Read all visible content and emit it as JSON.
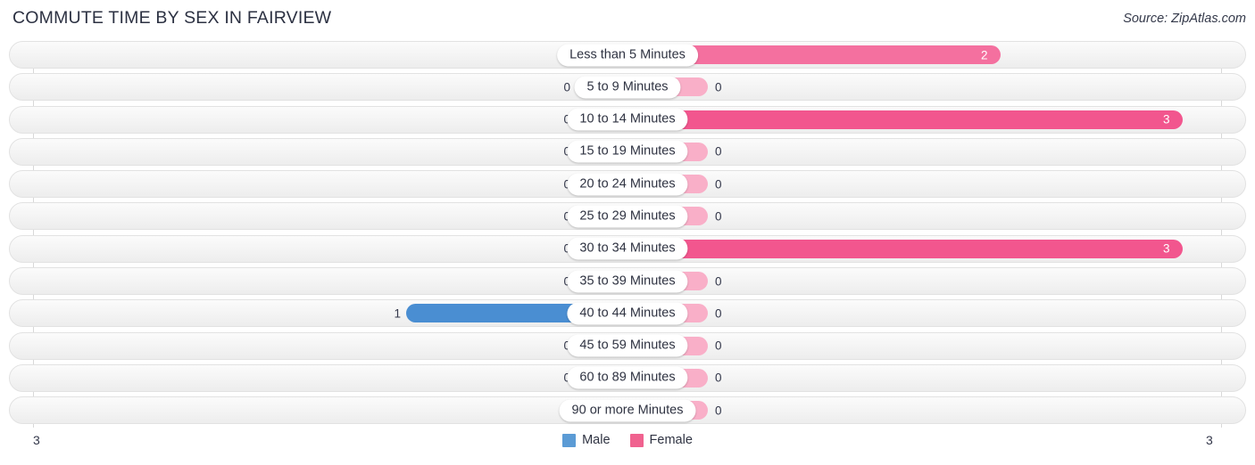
{
  "header": {
    "title": "COMMUTE TIME BY SEX IN FAIRVIEW",
    "source": "Source: ZipAtlas.com"
  },
  "legend": {
    "items": [
      {
        "label": "Male",
        "color": "#5B9BD5"
      },
      {
        "label": "Female",
        "color": "#F0628F"
      }
    ]
  },
  "axis": {
    "left_label": "3",
    "right_label": "3"
  },
  "colors": {
    "male_active": "#4A8ED2",
    "male_zero": "#A8C8EC",
    "female_active": "#F4709F",
    "female_high": "#F2568E",
    "female_zero": "#F9AFC8",
    "track": "#F4F4F4",
    "gridline": "#D8D8D8"
  },
  "chart_data": {
    "type": "bar",
    "title": "COMMUTE TIME BY SEX IN FAIRVIEW",
    "orientation": "horizontal",
    "layout": "diverging-bidirectional",
    "xlabel": "",
    "ylabel": "",
    "xlim": [
      3,
      3
    ],
    "grid": true,
    "legend_position": "bottom-center",
    "categories": [
      "Less than 5 Minutes",
      "5 to 9 Minutes",
      "10 to 14 Minutes",
      "15 to 19 Minutes",
      "20 to 24 Minutes",
      "25 to 29 Minutes",
      "30 to 34 Minutes",
      "35 to 39 Minutes",
      "40 to 44 Minutes",
      "45 to 59 Minutes",
      "60 to 89 Minutes",
      "90 or more Minutes"
    ],
    "series": [
      {
        "name": "Male",
        "values": [
          0,
          0,
          0,
          0,
          0,
          0,
          0,
          0,
          1,
          0,
          0,
          0
        ]
      },
      {
        "name": "Female",
        "values": [
          2,
          0,
          3,
          0,
          0,
          0,
          3,
          0,
          0,
          0,
          0,
          0
        ]
      }
    ]
  },
  "rows": [
    {
      "label": "Less than 5 Minutes",
      "male": "0",
      "female": "2",
      "male_w": 58,
      "male_zero": true,
      "female_w": 418,
      "female_zero": false,
      "female_high": false
    },
    {
      "label": "5 to 9 Minutes",
      "male": "0",
      "female": "0",
      "male_w": 58,
      "male_zero": true,
      "female_w": 90,
      "female_zero": true,
      "female_high": false
    },
    {
      "label": "10 to 14 Minutes",
      "male": "0",
      "female": "3",
      "male_w": 58,
      "male_zero": true,
      "female_w": 622,
      "female_zero": false,
      "female_high": true
    },
    {
      "label": "15 to 19 Minutes",
      "male": "0",
      "female": "0",
      "male_w": 58,
      "male_zero": true,
      "female_w": 90,
      "female_zero": true,
      "female_high": false
    },
    {
      "label": "20 to 24 Minutes",
      "male": "0",
      "female": "0",
      "male_w": 58,
      "male_zero": true,
      "female_w": 90,
      "female_zero": true,
      "female_high": false
    },
    {
      "label": "25 to 29 Minutes",
      "male": "0",
      "female": "0",
      "male_w": 58,
      "male_zero": true,
      "female_w": 90,
      "female_zero": true,
      "female_high": false
    },
    {
      "label": "30 to 34 Minutes",
      "male": "0",
      "female": "3",
      "male_w": 58,
      "male_zero": true,
      "female_w": 622,
      "female_zero": false,
      "female_high": true
    },
    {
      "label": "35 to 39 Minutes",
      "male": "0",
      "female": "0",
      "male_w": 58,
      "male_zero": true,
      "female_w": 90,
      "female_zero": true,
      "female_high": false
    },
    {
      "label": "40 to 44 Minutes",
      "male": "1",
      "female": "0",
      "male_w": 248,
      "male_zero": false,
      "female_w": 90,
      "female_zero": true,
      "female_high": false
    },
    {
      "label": "45 to 59 Minutes",
      "male": "0",
      "female": "0",
      "male_w": 58,
      "male_zero": true,
      "female_w": 90,
      "female_zero": true,
      "female_high": false
    },
    {
      "label": "60 to 89 Minutes",
      "male": "0",
      "female": "0",
      "male_w": 58,
      "male_zero": true,
      "female_w": 90,
      "female_zero": true,
      "female_high": false
    },
    {
      "label": "90 or more Minutes",
      "male": "0",
      "female": "0",
      "male_w": 58,
      "male_zero": true,
      "female_w": 90,
      "female_zero": true,
      "female_high": false
    }
  ]
}
